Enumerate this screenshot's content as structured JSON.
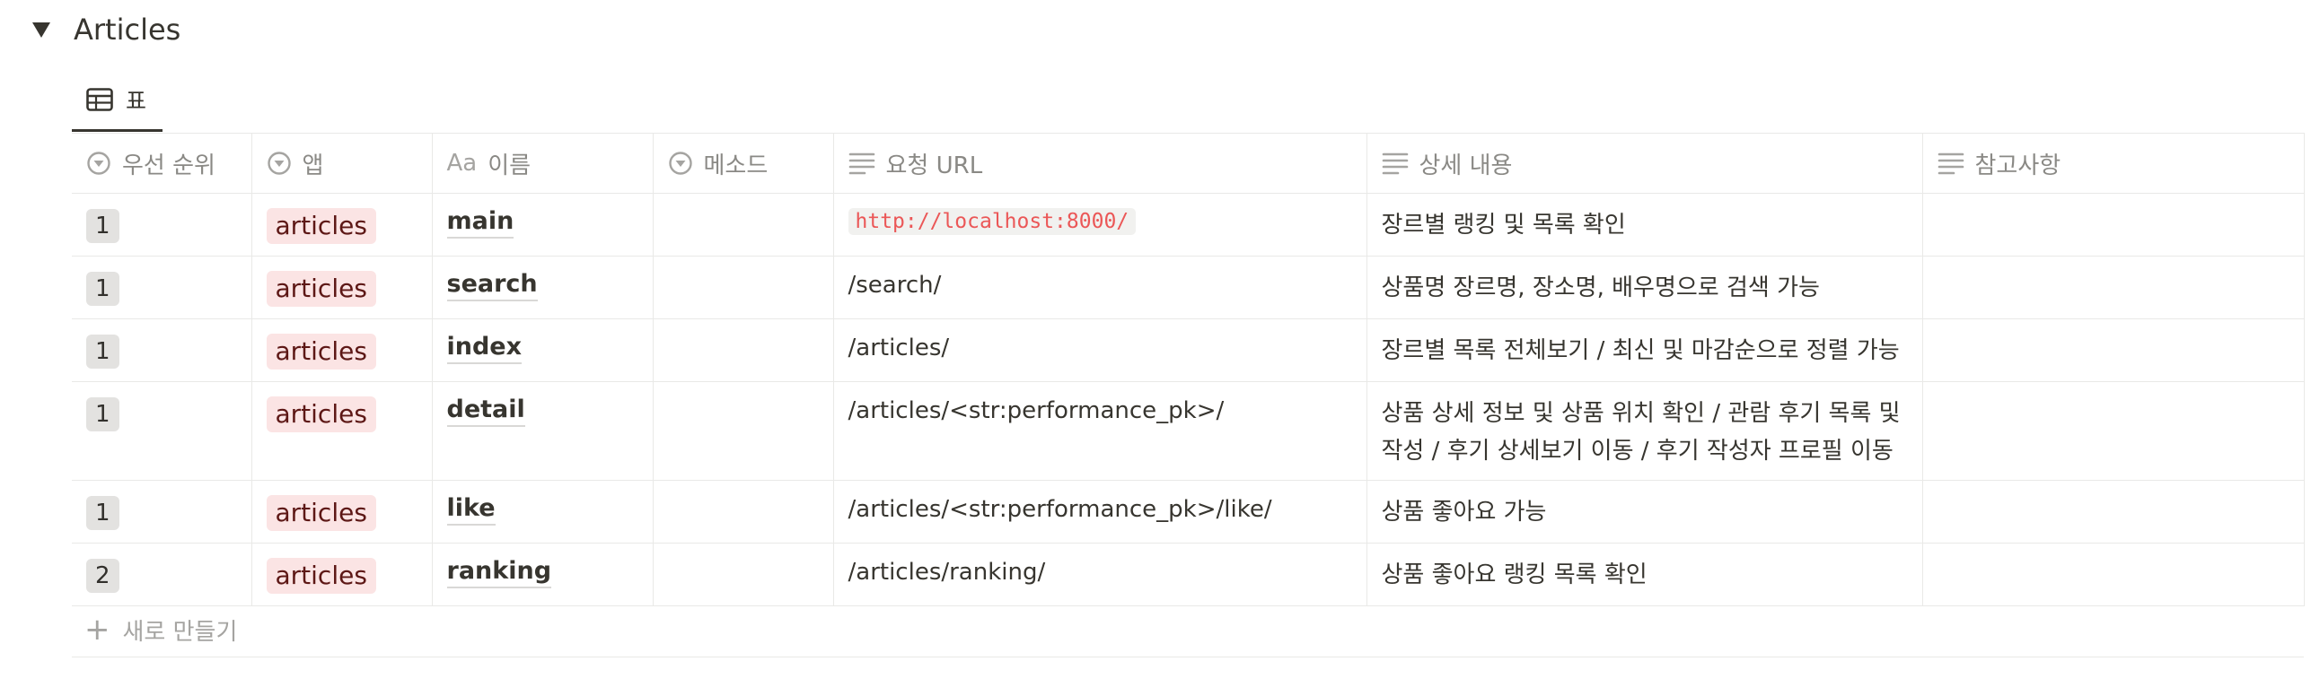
{
  "toggle": {
    "title": "Articles"
  },
  "view": {
    "tab_label": "표"
  },
  "columns": [
    {
      "label": "우선 순위",
      "icon": "select-icon"
    },
    {
      "label": "앱",
      "icon": "select-icon"
    },
    {
      "label": "이름",
      "icon": "title-icon"
    },
    {
      "label": "메소드",
      "icon": "select-icon"
    },
    {
      "label": "요청 URL",
      "icon": "text-icon"
    },
    {
      "label": "상세 내용",
      "icon": "text-icon"
    },
    {
      "label": "참고사항",
      "icon": "text-icon"
    }
  ],
  "title_icon_text": "Aa",
  "rows": [
    {
      "priority": "1",
      "app": "articles",
      "name": "main",
      "method": "",
      "url": "http://localhost:8000/",
      "desc": "장르별 랭킹 및 목록 확인",
      "notes": ""
    },
    {
      "priority": "1",
      "app": "articles",
      "name": "search",
      "method": "",
      "url": "/search/",
      "desc": "상품명 장르명, 장소명, 배우명으로 검색 가능",
      "notes": ""
    },
    {
      "priority": "1",
      "app": "articles",
      "name": "index",
      "method": "",
      "url": "/articles/",
      "desc": "장르별 목록 전체보기 / 최신 및 마감순으로 정렬 가능",
      "notes": ""
    },
    {
      "priority": "1",
      "app": "articles",
      "name": "detail",
      "method": "",
      "url": "/articles/<str:performance_pk>/",
      "desc": "상품 상세 정보 및 상품 위치 확인 / 관람 후기 목록 및 작성 / 후기 상세보기 이동 / 후기 작성자 프로필 이동",
      "notes": ""
    },
    {
      "priority": "1",
      "app": "articles",
      "name": "like",
      "method": "",
      "url": "/articles/<str:performance_pk>/like/",
      "desc": "상품 좋아요 가능",
      "notes": ""
    },
    {
      "priority": "2",
      "app": "articles",
      "name": "ranking",
      "method": "",
      "url": "/articles/ranking/",
      "desc": "상품 좋아요 랭킹 목록 확인",
      "notes": ""
    }
  ],
  "new_row": {
    "label": "새로 만들기"
  }
}
